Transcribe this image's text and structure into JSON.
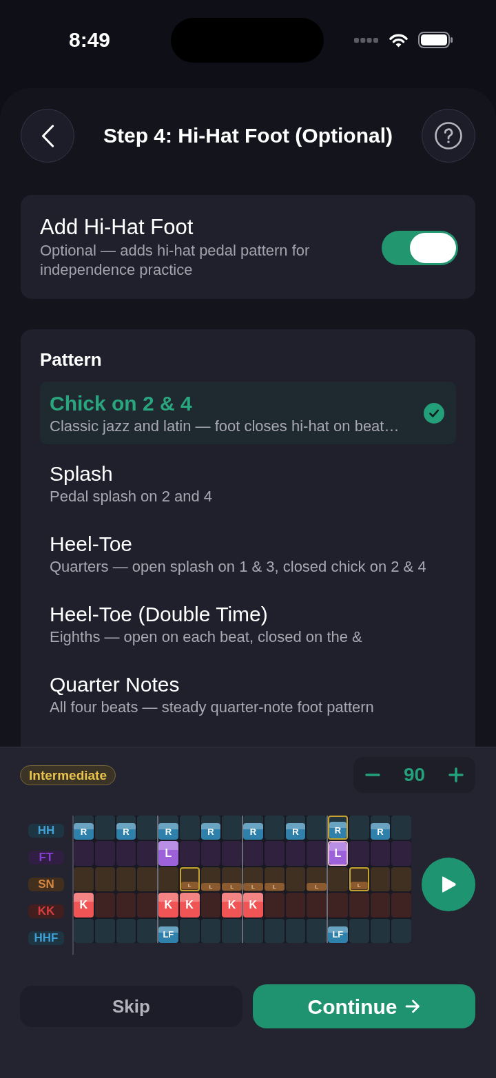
{
  "status_bar": {
    "time": "8:49"
  },
  "header": {
    "title": "Step 4: Hi-Hat Foot (Optional)"
  },
  "hi_hat_foot_toggle": {
    "title": "Add Hi-Hat Foot",
    "description": "Optional — adds hi-hat pedal pattern for independence practice",
    "on": true
  },
  "pattern": {
    "heading": "Pattern",
    "options": [
      {
        "title": "Chick on 2 & 4",
        "description": "Classic jazz and latin — foot closes hi-hat on beat…",
        "selected": true
      },
      {
        "title": "Splash",
        "description": "Pedal splash on 2 and 4",
        "selected": false
      },
      {
        "title": "Heel-Toe",
        "description": "Quarters — open splash on 1 & 3, closed chick on 2 & 4",
        "selected": false
      },
      {
        "title": "Heel-Toe (Double Time)",
        "description": "Eighths — open on each beat, closed on the &",
        "selected": false
      },
      {
        "title": "Quarter Notes",
        "description": "All four beats — steady quarter-note foot pattern",
        "selected": false
      }
    ]
  },
  "preview": {
    "difficulty": "Intermediate",
    "tempo": "90",
    "tracks": [
      {
        "label": "HH",
        "color": "#2f80aa",
        "cells": [
          {
            "kind": "cymbal",
            "text": "R",
            "outlined": false
          },
          {
            "kind": "rest",
            "outlined": false
          },
          {
            "kind": "cymbal",
            "text": "R",
            "outlined": false
          },
          {
            "kind": "rest",
            "outlined": false
          },
          {
            "kind": "cymbal",
            "text": "R",
            "outlined": false
          },
          {
            "kind": "rest",
            "outlined": false
          },
          {
            "kind": "cymbal",
            "text": "R",
            "outlined": false
          },
          {
            "kind": "rest",
            "outlined": false
          },
          {
            "kind": "cymbal",
            "text": "R",
            "outlined": false
          },
          {
            "kind": "rest",
            "outlined": false
          },
          {
            "kind": "cymbal",
            "text": "R",
            "outlined": false
          },
          {
            "kind": "rest",
            "outlined": false
          },
          {
            "kind": "cymbal",
            "text": "R",
            "outlined": true
          },
          {
            "kind": "rest",
            "outlined": false
          },
          {
            "kind": "cymbal",
            "text": "R",
            "outlined": false
          },
          {
            "kind": "rest",
            "outlined": false
          }
        ]
      },
      {
        "label": "FT",
        "color": "#9d62da",
        "cells": [
          {
            "kind": "rest",
            "outlined": false
          },
          {
            "kind": "rest",
            "outlined": false
          },
          {
            "kind": "rest",
            "outlined": false
          },
          {
            "kind": "rest",
            "outlined": false
          },
          {
            "kind": "drum",
            "text": "L",
            "outlined": false
          },
          {
            "kind": "rest",
            "outlined": false
          },
          {
            "kind": "rest",
            "outlined": false
          },
          {
            "kind": "rest",
            "outlined": false
          },
          {
            "kind": "rest",
            "outlined": false
          },
          {
            "kind": "rest",
            "outlined": false
          },
          {
            "kind": "rest",
            "outlined": false
          },
          {
            "kind": "rest",
            "outlined": false
          },
          {
            "kind": "drum",
            "text": "L",
            "outlined": true
          },
          {
            "kind": "rest",
            "outlined": false
          },
          {
            "kind": "rest",
            "outlined": false
          },
          {
            "kind": "rest",
            "outlined": false
          }
        ]
      },
      {
        "label": "SN",
        "color": "#8b5a2e",
        "cells": [
          {
            "kind": "rest",
            "outlined": false
          },
          {
            "kind": "rest",
            "outlined": false
          },
          {
            "kind": "rest",
            "outlined": false
          },
          {
            "kind": "rest",
            "outlined": false
          },
          {
            "kind": "rest",
            "outlined": false
          },
          {
            "kind": "ghost",
            "text": "L",
            "outlined": true
          },
          {
            "kind": "ghost",
            "text": "L",
            "outlined": false
          },
          {
            "kind": "ghost",
            "text": "L",
            "outlined": false
          },
          {
            "kind": "ghost",
            "text": "L",
            "outlined": false
          },
          {
            "kind": "ghost",
            "text": "L",
            "outlined": false
          },
          {
            "kind": "rest",
            "outlined": false
          },
          {
            "kind": "ghost",
            "text": "L",
            "outlined": false
          },
          {
            "kind": "rest",
            "outlined": false
          },
          {
            "kind": "ghost",
            "text": "L",
            "outlined": true
          },
          {
            "kind": "rest",
            "outlined": false
          },
          {
            "kind": "rest",
            "outlined": false
          }
        ]
      },
      {
        "label": "KK",
        "color": "#f05454",
        "cells": [
          {
            "kind": "drum",
            "text": "K",
            "outlined": false
          },
          {
            "kind": "rest",
            "outlined": false
          },
          {
            "kind": "rest",
            "outlined": false
          },
          {
            "kind": "rest",
            "outlined": false
          },
          {
            "kind": "drum",
            "text": "K",
            "outlined": false
          },
          {
            "kind": "drum",
            "text": "K",
            "outlined": false
          },
          {
            "kind": "rest",
            "outlined": false
          },
          {
            "kind": "drum",
            "text": "K",
            "outlined": false
          },
          {
            "kind": "drum",
            "text": "K",
            "outlined": false
          },
          {
            "kind": "rest",
            "outlined": false
          },
          {
            "kind": "rest",
            "outlined": false
          },
          {
            "kind": "rest",
            "outlined": false
          },
          {
            "kind": "rest",
            "outlined": false
          },
          {
            "kind": "rest",
            "outlined": false
          },
          {
            "kind": "rest",
            "outlined": false
          },
          {
            "kind": "rest",
            "outlined": false
          }
        ]
      },
      {
        "label": "HHF",
        "color": "#2f80aa",
        "cells": [
          {
            "kind": "rest",
            "outlined": false
          },
          {
            "kind": "rest",
            "outlined": false
          },
          {
            "kind": "rest",
            "outlined": false
          },
          {
            "kind": "rest",
            "outlined": false
          },
          {
            "kind": "cymbal",
            "text": "LF",
            "outlined": false
          },
          {
            "kind": "rest",
            "outlined": false
          },
          {
            "kind": "rest",
            "outlined": false
          },
          {
            "kind": "rest",
            "outlined": false
          },
          {
            "kind": "rest",
            "outlined": false
          },
          {
            "kind": "rest",
            "outlined": false
          },
          {
            "kind": "rest",
            "outlined": false
          },
          {
            "kind": "rest",
            "outlined": false
          },
          {
            "kind": "cymbal",
            "text": "LF",
            "outlined": false
          },
          {
            "kind": "rest",
            "outlined": false
          },
          {
            "kind": "rest",
            "outlined": false
          },
          {
            "kind": "rest",
            "outlined": false
          }
        ]
      }
    ]
  },
  "buttons": [
    {
      "label": "Skip",
      "kind": "secondary"
    },
    {
      "label": "Continue",
      "kind": "primary"
    }
  ]
}
